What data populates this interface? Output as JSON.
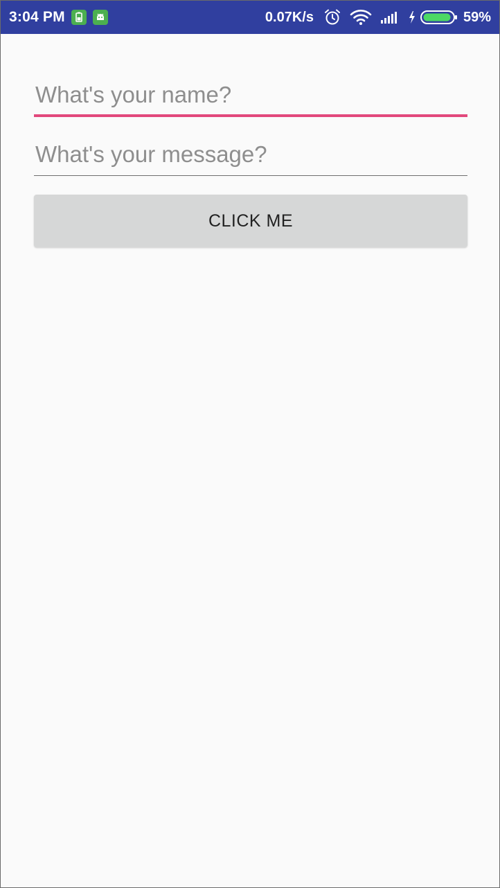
{
  "status_bar": {
    "time": "3:04 PM",
    "network_speed": "0.07K/s",
    "battery_percent": "59%",
    "background_color": "#303f9f",
    "notification_icons": [
      "battery-saver-icon",
      "android-icon"
    ],
    "system_icons": [
      "alarm-icon",
      "wifi-icon",
      "cellular-signal-icon",
      "charging-bolt-icon",
      "battery-icon"
    ]
  },
  "form": {
    "name_field": {
      "value": "",
      "placeholder": "What's your name?",
      "focused": true,
      "underline_color": "#e2487c"
    },
    "message_field": {
      "value": "",
      "placeholder": "What's your message?",
      "focused": false,
      "underline_color": "#6d6d6d"
    },
    "submit_button": {
      "label": "CLICK ME",
      "background_color": "#d6d7d7"
    }
  }
}
